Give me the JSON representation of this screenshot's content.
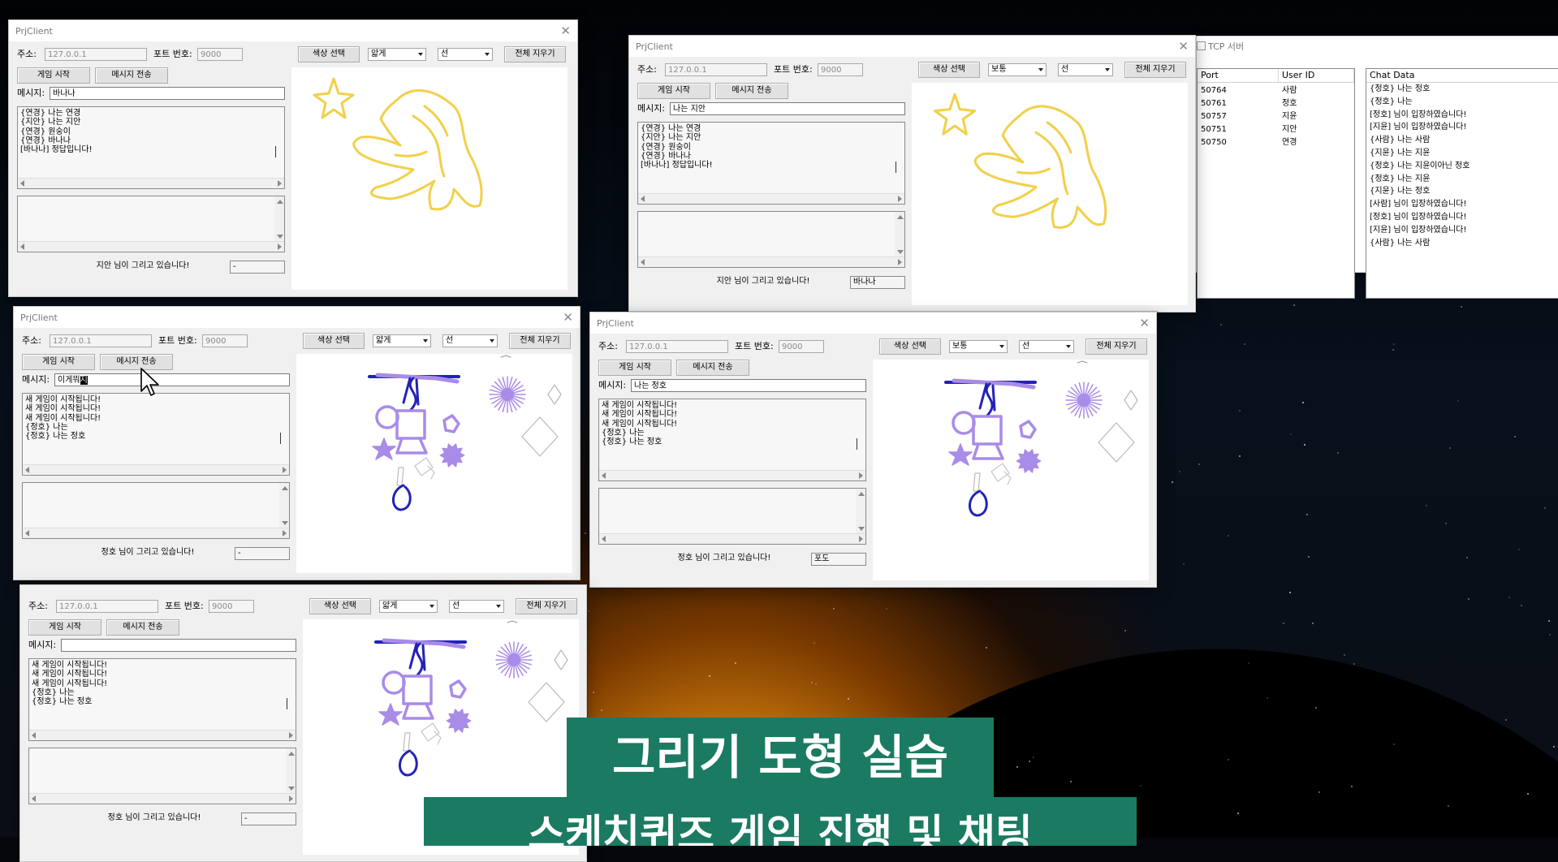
{
  "app_title": "PrjClient",
  "server": {
    "title": "TCP 서버",
    "columns": [
      "Port",
      "User ID"
    ],
    "rows": [
      [
        "50764",
        "사람"
      ],
      [
        "50761",
        "정호"
      ],
      [
        "50757",
        "지윤"
      ],
      [
        "50751",
        "지안"
      ],
      [
        "50750",
        "연경"
      ]
    ],
    "chat_header": "Chat Data",
    "chat": [
      "{정호} 나는 정호",
      "{정호} 나는",
      "[정호] 님이 입장하였습니다!",
      "[지윤] 님이 입장하였습니다!",
      "{사람} 나는 사람",
      "{지윤} 나는 지윤",
      "{정호} 나는 지윤이아닌 정호",
      "{정호} 나는 지윤",
      "{지윤} 나는 정호",
      "[사람] 님이 입장하였습니다!",
      "[정호] 님이 입장하였습니다!",
      "[지윤] 님이 입장하였습니다!",
      "{사람} 나는 사람"
    ]
  },
  "labels": {
    "address": "주소:",
    "port": "포트 번호:",
    "message": "메시지:",
    "color_button": "색상 선택",
    "clear_button": "전체 지우기",
    "start_button": "게임 시작",
    "send_button": "메시지 전송"
  },
  "clients": [
    {
      "address": "127.0.0.1",
      "port": "9000",
      "thickness": "얇게",
      "shape": "선",
      "message": "바나나",
      "chat": [
        "{연경} 나는 연경",
        "{지안} 나는 지안",
        "{연경} 원숭이",
        "{연경} 바나나",
        "[바나나] 정답입니다!"
      ],
      "status": "지안  님이 그리고 있습니다!",
      "answer": "-"
    },
    {
      "address": "127.0.0.1",
      "port": "9000",
      "thickness": "보통",
      "shape": "선",
      "message": "나는 지안",
      "chat": [
        "{연경} 나는 연경",
        "{지안} 나는 지안",
        "{연경} 원숭이",
        "{연경} 바나나",
        "[바나나] 정답입니다!"
      ],
      "status": "지안  님이 그리고 있습니다!",
      "answer": "바나나"
    },
    {
      "address": "127.0.0.1",
      "port": "9000",
      "thickness": "얇게",
      "shape": "선",
      "message_prefix": "이게뭐",
      "message_selected": "지",
      "chat": [
        "새 게임이 시작됩니다!",
        "새 게임이 시작됩니다!",
        "새 게임이 시작됩니다!",
        "{정호} 나는",
        "{정호} 나는 정호"
      ],
      "status": "정호  님이 그리고 있습니다!",
      "answer": "-"
    },
    {
      "address": "127.0.0.1",
      "port": "9000",
      "thickness": "보통",
      "shape": "선",
      "message": "나는 정호",
      "chat": [
        "새 게임이 시작됩니다!",
        "새 게임이 시작됩니다!",
        "새 게임이 시작됩니다!",
        "{정호} 나는",
        "{정호} 나는 정호"
      ],
      "status": "정호  님이 그리고 있습니다!",
      "answer": "포도"
    },
    {
      "address": "127.0.0.1",
      "port": "9000",
      "thickness": "얇게",
      "shape": "선",
      "message": "",
      "chat": [
        "새 게임이 시작됩니다!",
        "새 게임이 시작됩니다!",
        "새 게임이 시작됩니다!",
        "{정호} 나는",
        "{정호} 나는 정호"
      ],
      "status": "정호  님이 그리고 있습니다!",
      "answer": "-"
    }
  ],
  "captions": [
    "그리기 도형 실습",
    "스케치퀴즈 게임 진행 및 채팅"
  ],
  "colors": {
    "banner": "#1a7a62",
    "banana": "#f2d04a",
    "shape_purple": "#a98be8",
    "stroke_blue": "#2222b8"
  }
}
